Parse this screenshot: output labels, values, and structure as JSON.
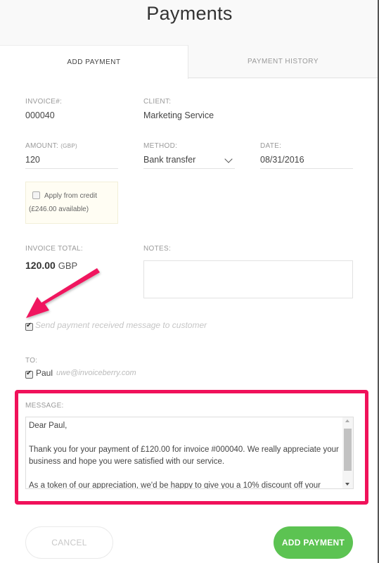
{
  "page": {
    "title": "Payments"
  },
  "tabs": [
    {
      "label": "ADD PAYMENT",
      "active": true
    },
    {
      "label": "PAYMENT HISTORY",
      "active": false
    }
  ],
  "form": {
    "invoice": {
      "label": "INVOICE#:",
      "value": "000040"
    },
    "client": {
      "label": "CLIENT:",
      "value": "Marketing Service"
    },
    "amount": {
      "label": "AMOUNT:",
      "unit": "(GBP)",
      "value": "120"
    },
    "method": {
      "label": "METHOD:",
      "value": "Bank transfer"
    },
    "date": {
      "label": "DATE:",
      "value": "08/31/2016"
    },
    "credit": {
      "label": "Apply from credit",
      "available": "(£246.00 available)",
      "checked": false
    },
    "invoice_total": {
      "label": "INVOICE TOTAL:",
      "amount": "120.00",
      "currency": "GBP"
    },
    "notes": {
      "label": "NOTES:",
      "value": ""
    },
    "send_message": {
      "label": "Send payment received message to customer",
      "checked": true
    },
    "to": {
      "label": "TO:",
      "name": "Paul",
      "email": "uwe@invoiceberry.com",
      "checked": true
    },
    "message": {
      "label": "MESSAGE:",
      "lines": [
        "Dear Paul,",
        "",
        "Thank you for your payment of £120.00 for invoice #000040. We really appreciate your business and hope you were satisfied with our service.",
        "",
        "As a token of our appreciation, we'd be happy to give you a 10% discount off your"
      ]
    }
  },
  "buttons": {
    "cancel": "CANCEL",
    "add_payment": "ADD PAYMENT"
  },
  "colors": {
    "accent_green": "#5cc352",
    "highlight_pink": "#f0115a"
  }
}
